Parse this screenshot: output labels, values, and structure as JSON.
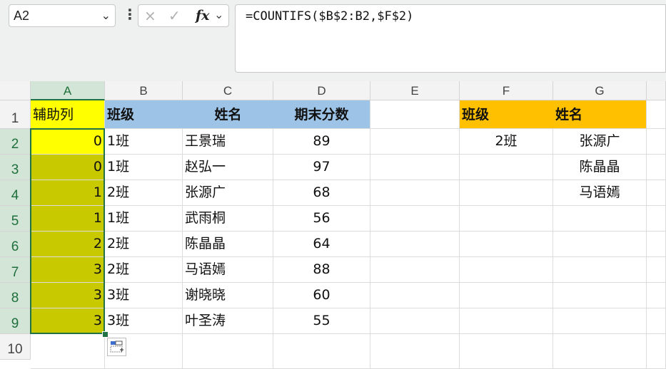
{
  "name_box": {
    "value": "A2"
  },
  "formula_bar": {
    "cancel_icon": "×",
    "enter_icon": "✓",
    "fx_label": "fx",
    "formula": "=COUNTIFS($B$2:B2,$F$2)"
  },
  "column_headers": [
    "A",
    "B",
    "C",
    "D",
    "E",
    "F",
    "G"
  ],
  "row_headers": [
    "1",
    "2",
    "3",
    "4",
    "5",
    "6",
    "7",
    "8",
    "9",
    "10"
  ],
  "table": {
    "headers": [
      "辅助列",
      "班级",
      "姓名",
      "期末分数"
    ],
    "rows": [
      [
        "0",
        "1班",
        "王景瑞",
        "89"
      ],
      [
        "0",
        "1班",
        "赵弘一",
        "97"
      ],
      [
        "1",
        "2班",
        "张源广",
        "68"
      ],
      [
        "1",
        "1班",
        "武雨桐",
        "56"
      ],
      [
        "2",
        "2班",
        "陈晶晶",
        "64"
      ],
      [
        "3",
        "2班",
        "马语嫣",
        "88"
      ],
      [
        "3",
        "3班",
        "谢晓晓",
        "60"
      ],
      [
        "3",
        "3班",
        "叶圣涛",
        "55"
      ]
    ]
  },
  "lookup": {
    "headers": [
      "班级",
      "姓名"
    ],
    "class_value": "2班",
    "names": [
      "张源广",
      "陈晶晶",
      "马语嫣"
    ]
  },
  "colors": {
    "helper_header": "#ffff00",
    "helper_active": "#ffff00",
    "helper_fill": "#c9c900",
    "table_header": "#9dc3e6",
    "lookup_header": "#ffc000",
    "selection": "#217346"
  }
}
